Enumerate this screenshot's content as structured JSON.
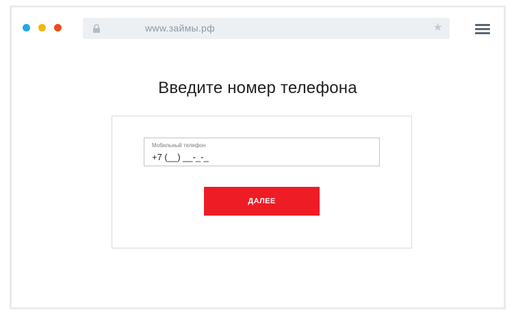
{
  "browser": {
    "url": "www.займы.рф",
    "window_controls": [
      "close-dot",
      "minimize-dot",
      "maximize-dot"
    ],
    "icons": [
      "lock-icon",
      "star-icon",
      "hamburger-menu-icon"
    ]
  },
  "page": {
    "title": "Введите номер телефона"
  },
  "form": {
    "phone_label": "Мобильный телефон",
    "phone_value": "+7 (__) __-_-_",
    "submit_label": "ДАЛЕЕ"
  },
  "colors": {
    "accent_button": "#ee1c25",
    "dot_blue": "#20a8e8",
    "dot_yellow": "#f6b60f",
    "dot_red": "#ec4b1a",
    "addressbar_bg": "#edf0f3"
  }
}
